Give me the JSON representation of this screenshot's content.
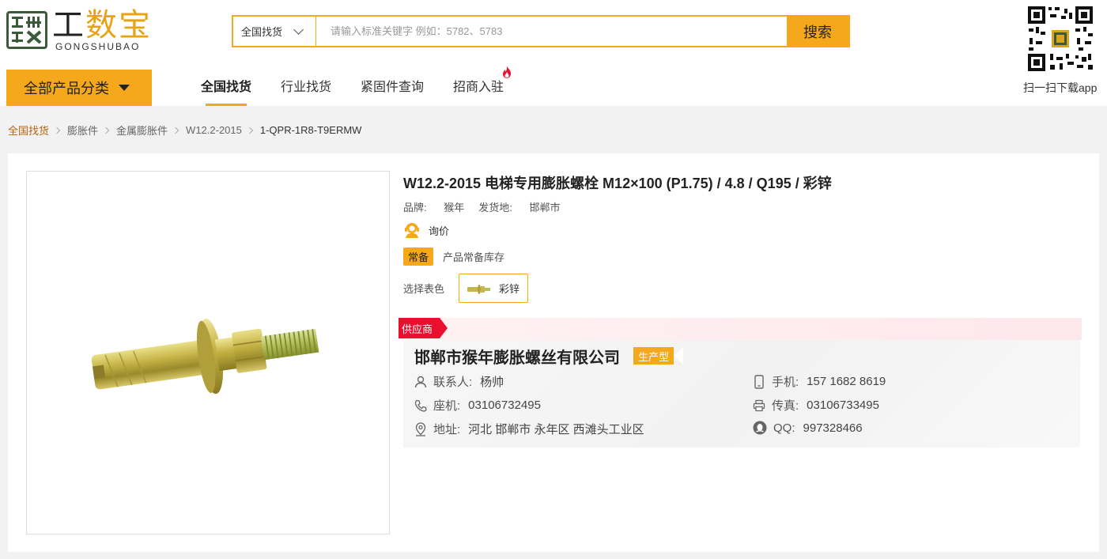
{
  "logo": {
    "mark_text": "工数宝",
    "cn_black": "工",
    "cn_yellow": "数宝",
    "en": "GONGSHUBAO"
  },
  "search": {
    "scope": "全国找货",
    "placeholder": "请输入标准关键字 例如：5782、5783",
    "button": "搜索"
  },
  "qr": {
    "caption": "扫一扫下载app"
  },
  "category_button": "全部产品分类",
  "nav": {
    "items": [
      {
        "label": "全国找货",
        "active": true
      },
      {
        "label": "行业找货"
      },
      {
        "label": "紧固件查询"
      },
      {
        "label": "招商入驻",
        "hot": true
      }
    ]
  },
  "breadcrumb": [
    "全国找货",
    "膨胀件",
    "金属膨胀件",
    "W12.2-2015",
    "1-QPR-1R8-T9ERMW"
  ],
  "product": {
    "title": "W12.2-2015 电梯专用膨胀螺栓 M12×100 (P1.75) / 4.8 / Q195 / 彩锌",
    "brand_label": "品牌:",
    "brand": "猴年",
    "origin_label": "发货地:",
    "origin": "邯郸市",
    "inquiry": "询价",
    "stock_tag": "常备",
    "stock_text": "产品常备库存",
    "color_label": "选择表色",
    "color_option": "彩锌"
  },
  "supplier": {
    "tag": "供应商",
    "company": "邯郸市猴年膨胀螺丝有限公司",
    "company_type": "生产型",
    "contact_label": "联系人:",
    "contact": "杨帅",
    "phone_label": "座机:",
    "phone": "03106732495",
    "address_label": "地址:",
    "address": "河北 邯郸市 永年区 西滩头工业区",
    "mobile_label": "手机:",
    "mobile": "157 1682 8619",
    "fax_label": "传真:",
    "fax": "03106733495",
    "qq_label": "QQ:",
    "qq": "997328466"
  },
  "colors": {
    "accent": "#f5a81b",
    "supplier_red": "#e8102e",
    "breadcrumb_active": "#b8620e"
  }
}
